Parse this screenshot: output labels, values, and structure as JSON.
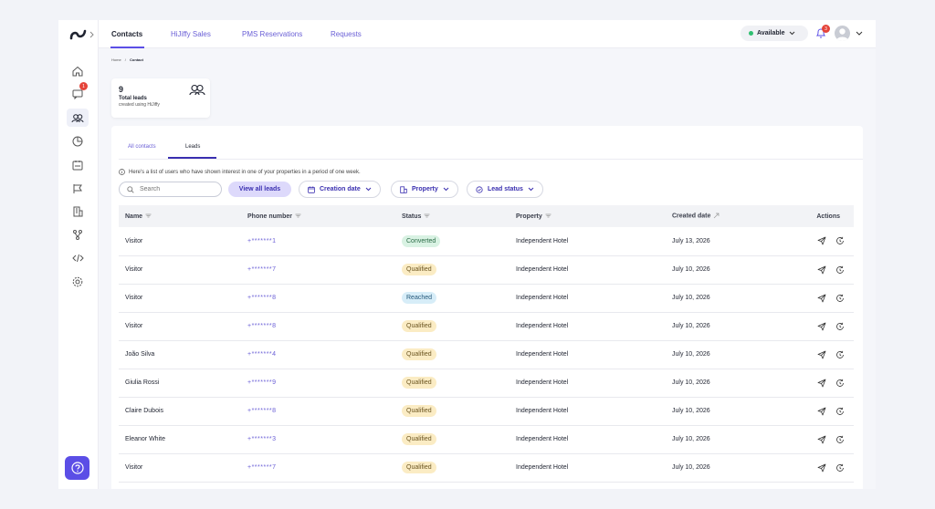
{
  "top_tabs": [
    "Contacts",
    "HiJiffy Sales",
    "PMS Reservations",
    "Requests"
  ],
  "availability": "Available",
  "notification_count": "3",
  "chat_badge": "1",
  "breadcrumb": {
    "home": "Home",
    "sep": "/",
    "current": "Contact"
  },
  "stat": {
    "count": "9",
    "label": "Total leads",
    "sub": "created using HiJiffy"
  },
  "sub_tabs": [
    "All contacts",
    "Leads"
  ],
  "info_text": "Here's a list of users who have shown interest in one of your properties in a period of one week.",
  "search": {
    "placeholder": "Search"
  },
  "view_all": "View all leads",
  "filters": [
    "Creation date",
    "Property",
    "Lead status"
  ],
  "columns": [
    "Name",
    "Phone number",
    "Status",
    "Property",
    "Created date",
    "Actions"
  ],
  "rows": [
    {
      "name": "Visitor",
      "phone": "+*******1",
      "status": "Converted",
      "property": "Independent Hotel",
      "date": "July 13, 2026"
    },
    {
      "name": "Visitor",
      "phone": "+*******7",
      "status": "Qualified",
      "property": "Independent Hotel",
      "date": "July 10, 2026"
    },
    {
      "name": "Visitor",
      "phone": "+*******8",
      "status": "Reached",
      "property": "Independent Hotel",
      "date": "July 10, 2026"
    },
    {
      "name": "Visitor",
      "phone": "+*******8",
      "status": "Qualified",
      "property": "Independent Hotel",
      "date": "July 10, 2026"
    },
    {
      "name": "João Silva",
      "phone": "+*******4",
      "status": "Qualified",
      "property": "Independent Hotel",
      "date": "July 10, 2026"
    },
    {
      "name": "Giulia Rossi",
      "phone": "+*******9",
      "status": "Qualified",
      "property": "Independent Hotel",
      "date": "July 10, 2026"
    },
    {
      "name": "Claire Dubois",
      "phone": "+*******8",
      "status": "Qualified",
      "property": "Independent Hotel",
      "date": "July 10, 2026"
    },
    {
      "name": "Eleanor White",
      "phone": "+*******3",
      "status": "Qualified",
      "property": "Independent Hotel",
      "date": "July 10, 2026"
    },
    {
      "name": "Visitor",
      "phone": "+*******7",
      "status": "Qualified",
      "property": "Independent Hotel",
      "date": "July 10, 2026"
    }
  ],
  "colors": {
    "accent": "#5b4ee6",
    "converted": "#d9f2e3",
    "qualified": "#fbecc4",
    "reached": "#d7edf8"
  }
}
